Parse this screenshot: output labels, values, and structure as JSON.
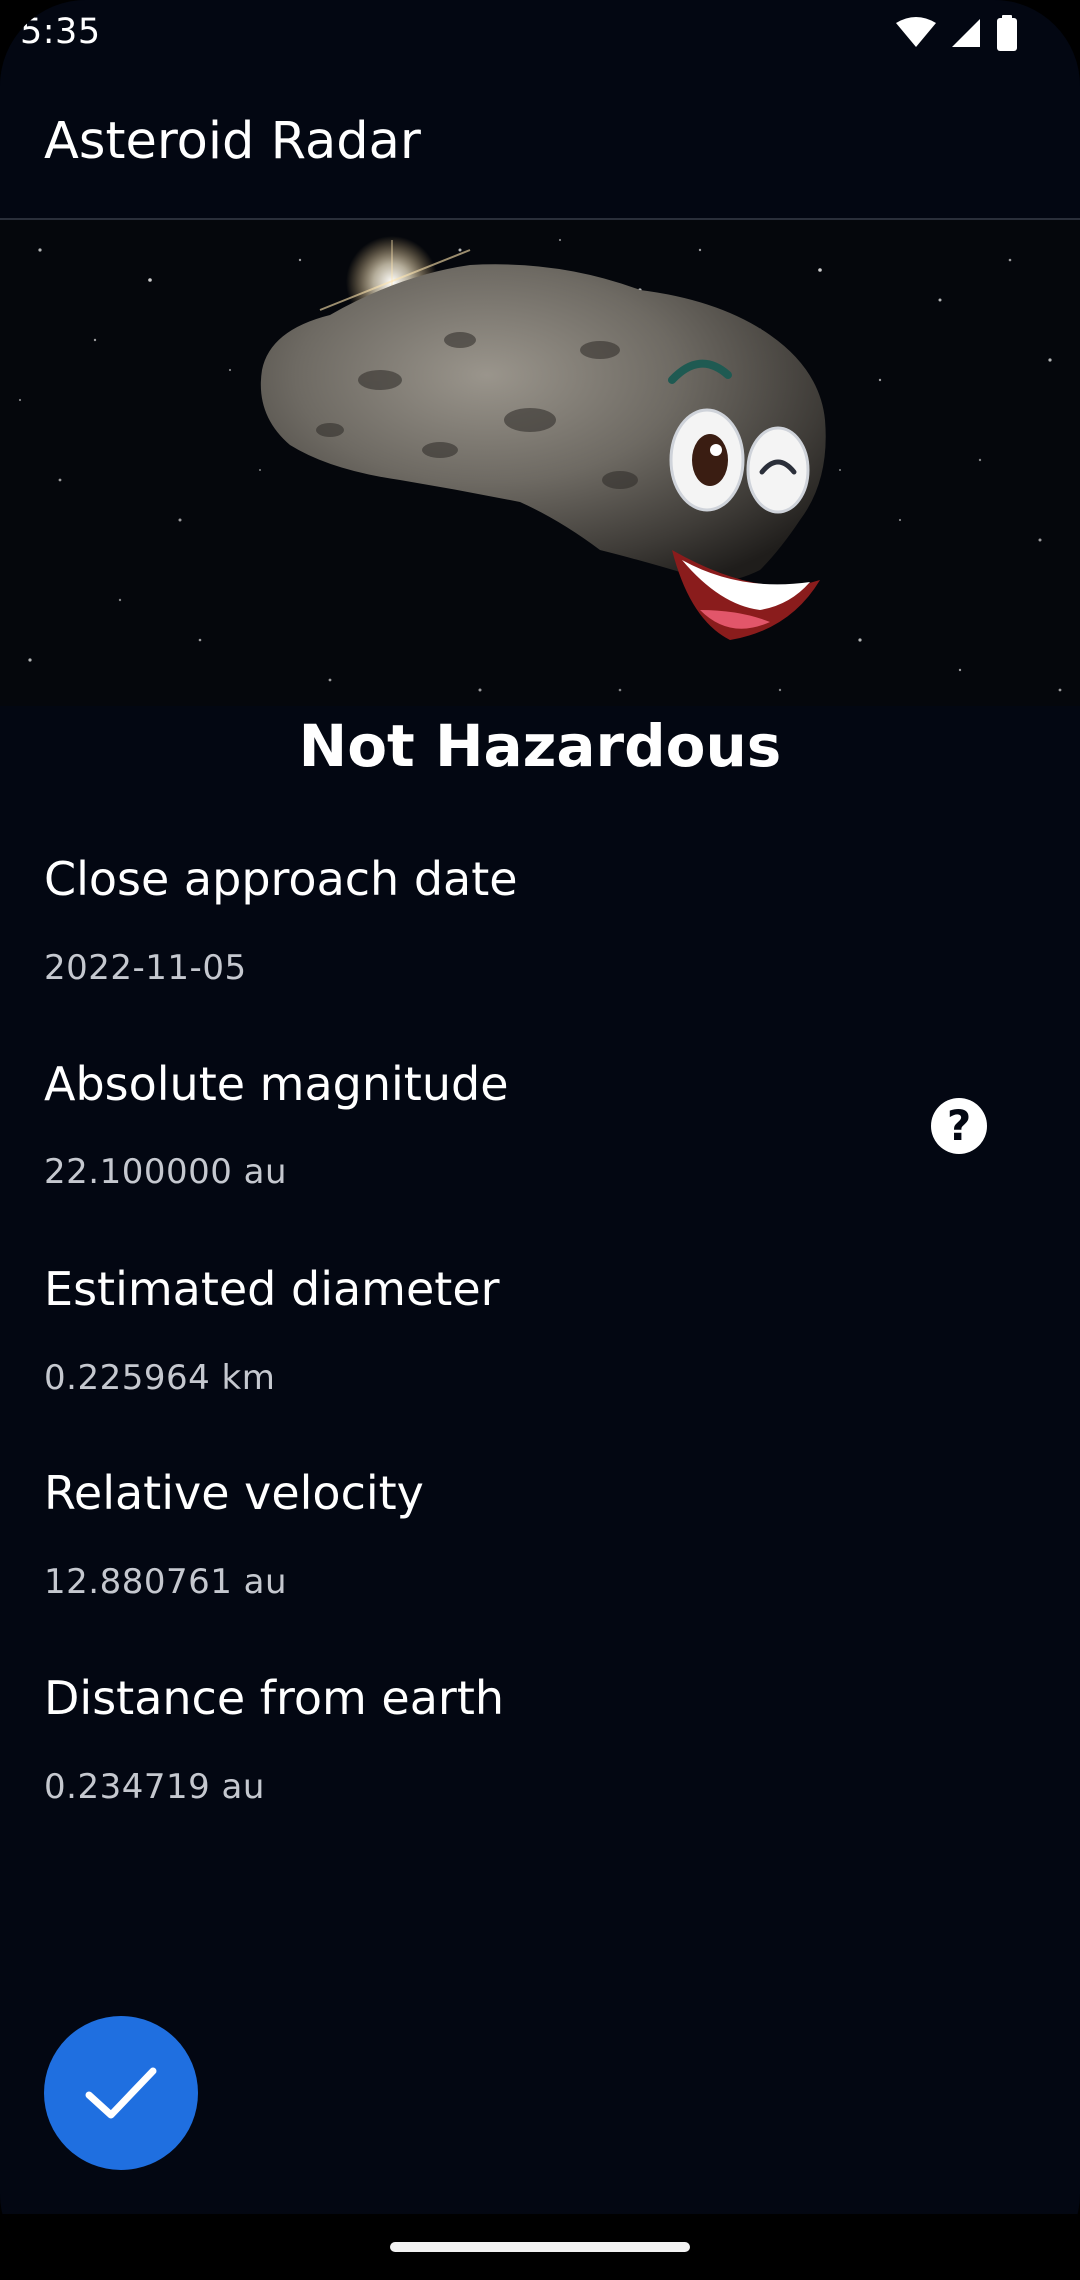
{
  "status_bar": {
    "time": "5:35",
    "icons": [
      "wifi-icon",
      "cellular-signal-icon",
      "battery-icon"
    ]
  },
  "app_bar": {
    "title": "Asteroid Radar"
  },
  "hero": {
    "image": "smiling-asteroid-image"
  },
  "hazard_status": "Not Hazardous",
  "fields": {
    "close_approach_date": {
      "label": "Close approach date",
      "value": "2022-11-05"
    },
    "absolute_magnitude": {
      "label": "Absolute magnitude",
      "value": "22.100000 au"
    },
    "estimated_diameter": {
      "label": "Estimated diameter",
      "value": "0.225964 km"
    },
    "relative_velocity": {
      "label": "Relative velocity",
      "value": "12.880761 au"
    },
    "distance_from_earth": {
      "label": "Distance from earth",
      "value": "0.234719 au"
    }
  },
  "help_button": {
    "icon": "help-icon",
    "glyph": "?"
  },
  "fab": {
    "icon": "check-icon",
    "color": "#1f6fe0"
  },
  "colors": {
    "background": "#030712",
    "accent": "#1f6fe0",
    "text_primary": "#ffffff",
    "text_secondary": "#c5c8cf"
  }
}
